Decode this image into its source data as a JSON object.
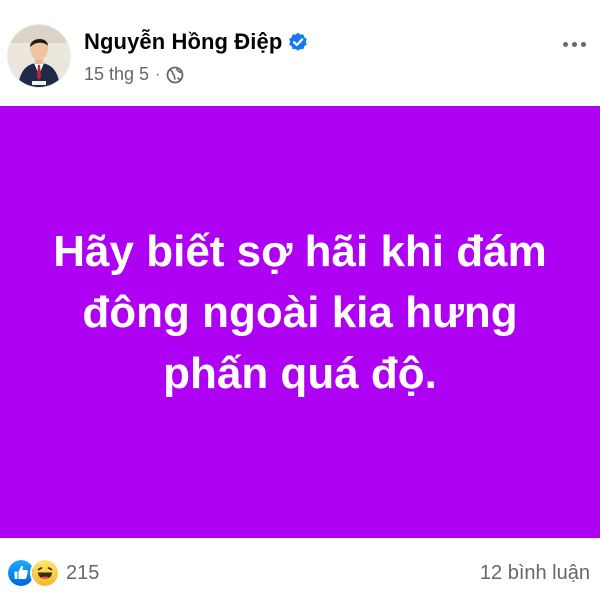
{
  "post": {
    "author": {
      "name": "Nguyễn Hồng Điệp",
      "verified": true
    },
    "timestamp": "15 thg 5",
    "separator": "·",
    "audience_icon": "globe-icon",
    "more_icon": "more-horizontal-icon",
    "background_color": "#ae00f2",
    "status_text": "Hãy biết sợ hãi khi đám đông ngoài kia hưng phấn quá độ.",
    "reactions": {
      "icons": [
        "like-icon",
        "haha-icon"
      ],
      "count": "215"
    },
    "comments_label": "12 bình luận"
  }
}
